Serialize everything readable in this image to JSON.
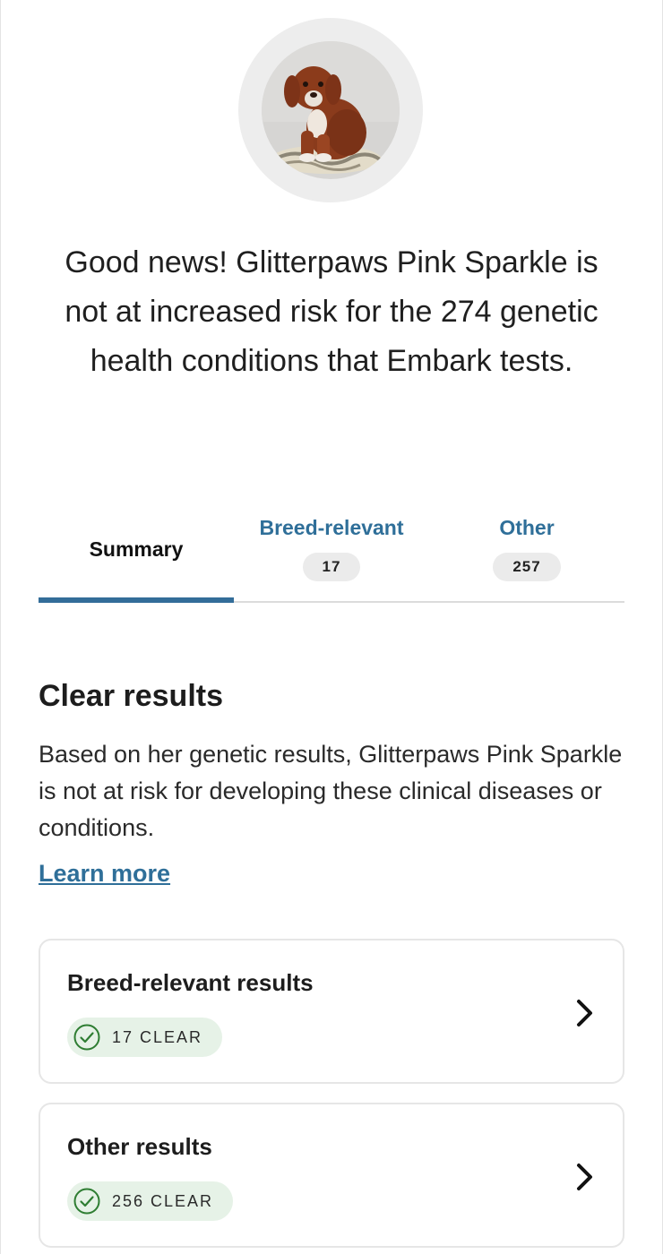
{
  "headline": "Good news! Glitterpaws Pink Sparkle is not at increased risk for the 274 genetic health conditions that Embark tests.",
  "tabs": [
    {
      "label": "Summary",
      "count": null,
      "active": true
    },
    {
      "label": "Breed-relevant",
      "count": "17",
      "active": false
    },
    {
      "label": "Other",
      "count": "257",
      "active": false
    }
  ],
  "section": {
    "title": "Clear results",
    "description": "Based on her genetic results, Glitterpaws Pink Sparkle is not at risk for developing these clinical diseases or conditions.",
    "learn_more": "Learn more"
  },
  "cards": [
    {
      "title": "Breed-relevant results",
      "badge": "17 CLEAR",
      "icon": "check-circle-icon"
    },
    {
      "title": "Other results",
      "badge": "256 CLEAR",
      "icon": "check-circle-icon"
    }
  ],
  "colors": {
    "accent_blue": "#336d99",
    "clear_badge_bg": "#e6f2e7",
    "check_green": "#2e7d32"
  }
}
